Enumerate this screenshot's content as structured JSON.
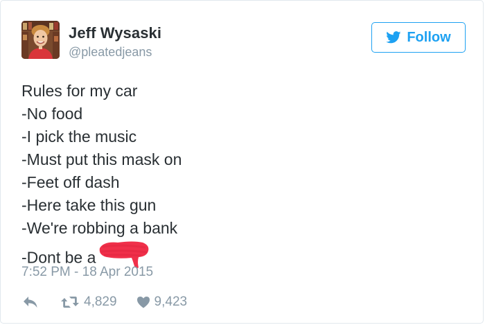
{
  "user": {
    "display_name": "Jeff Wysaski",
    "handle": "@pleatedjeans",
    "avatar_icon": "user-avatar-photo"
  },
  "follow_button": {
    "label": "Follow",
    "icon": "twitter-bird-icon",
    "color": "#1da1f2"
  },
  "tweet": {
    "lines": [
      "Rules for my car",
      "-No food",
      "-I pick the music",
      "-Must put this mask on",
      "-Feet off dash",
      "-Here take this gun",
      "-We're robbing a bank",
      "-Dont be a"
    ],
    "redaction_color": "#f0304a"
  },
  "timestamp": "7:52 PM - 18 Apr 2015",
  "actions": {
    "reply_icon": "reply-icon",
    "retweet_icon": "retweet-icon",
    "retweet_count": "4,829",
    "like_icon": "heart-icon",
    "like_count": "9,423"
  }
}
